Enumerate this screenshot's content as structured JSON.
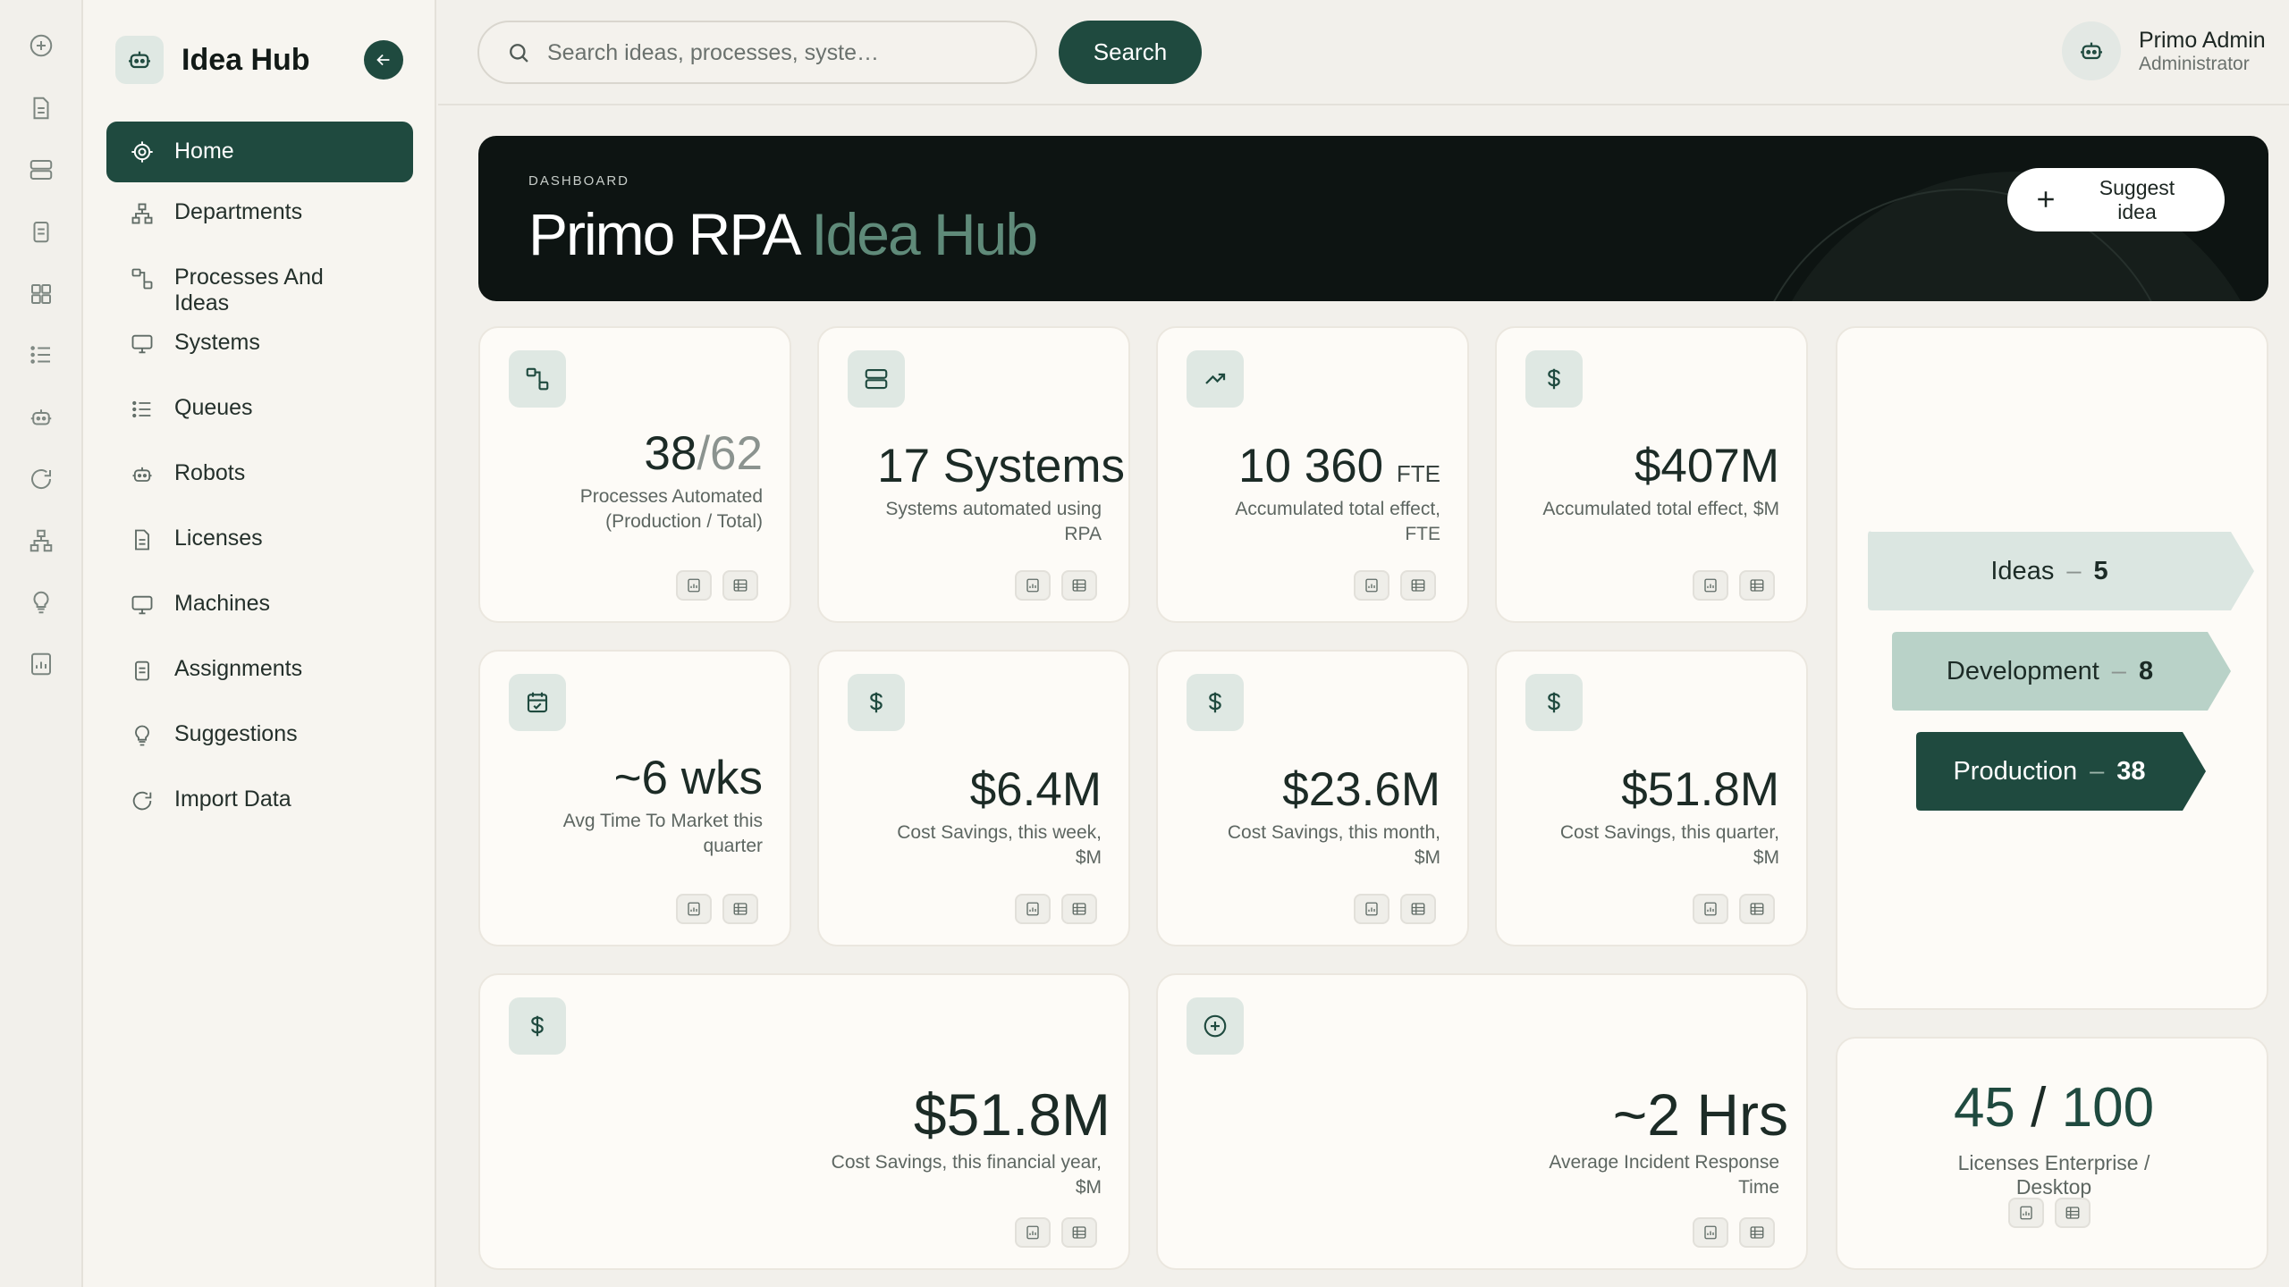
{
  "app": {
    "title": "Idea Hub"
  },
  "rail": {
    "icons": [
      "plus-circle-icon",
      "document-icon",
      "server-icon",
      "clipboard-icon",
      "grid-icon",
      "list-icon",
      "robot-icon",
      "refresh-icon",
      "hierarchy-icon",
      "lightbulb-icon",
      "chart-icon"
    ]
  },
  "sidebar": {
    "items": [
      {
        "label": "Home",
        "icon": "target-icon",
        "active": true
      },
      {
        "label": "Departments",
        "icon": "hierarchy-icon"
      },
      {
        "label": "Processes And\nIdeas",
        "icon": "process-icon"
      },
      {
        "label": "Systems",
        "icon": "monitor-icon"
      },
      {
        "label": "Queues",
        "icon": "list-icon"
      },
      {
        "label": "Robots",
        "icon": "robot-icon"
      },
      {
        "label": "Licenses",
        "icon": "document-icon"
      },
      {
        "label": "Machines",
        "icon": "monitor-icon"
      },
      {
        "label": "Assignments",
        "icon": "clipboard-icon"
      },
      {
        "label": "Suggestions",
        "icon": "lightbulb-icon"
      },
      {
        "label": "Import Data",
        "icon": "refresh-icon"
      }
    ]
  },
  "search": {
    "placeholder": "Search ideas, processes, syste…",
    "button_label": "Search"
  },
  "user": {
    "name": "Primo Admin",
    "role": "Administrator"
  },
  "hero": {
    "eyebrow": "DASHBOARD",
    "title_main": "Primo RPA",
    "title_accent": "Idea Hub",
    "suggest_label": "Suggest\nidea"
  },
  "cards": [
    {
      "icon": "process-icon",
      "value": "38",
      "value_muted": "/62",
      "desc": "Processes Automated\n(Production / Total)"
    },
    {
      "icon": "server-icon",
      "value": "17 Systems",
      "desc": "Systems automated using\nRPA"
    },
    {
      "icon": "trend-up-icon",
      "value": "10 360",
      "unit": "FTE",
      "desc": "Accumulated total effect,\nFTE"
    },
    {
      "icon": "dollar-icon",
      "value": "$407M",
      "desc": "Accumulated total effect, $M"
    },
    {
      "icon": "calendar-icon",
      "value": "~6 wks",
      "desc": "Avg Time To Market this\nquarter"
    },
    {
      "icon": "dollar-icon",
      "value": "$6.4M",
      "desc": "Cost Savings, this week,\n$M"
    },
    {
      "icon": "dollar-icon",
      "value": "$23.6M",
      "desc": "Cost Savings, this month,\n$M"
    },
    {
      "icon": "dollar-icon",
      "value": "$51.8M",
      "desc": "Cost Savings, this quarter,\n$M"
    },
    {
      "icon": "dollar-icon",
      "value": "$51.8M",
      "desc": "Cost Savings, this financial year,\n$M"
    },
    {
      "icon": "plus-circle-icon",
      "value": "~2 Hrs",
      "desc": "Average Incident Response\nTime"
    }
  ],
  "pipeline": [
    {
      "label": "Ideas",
      "count": "5",
      "color": "#dbe6e1"
    },
    {
      "label": "Development",
      "count": "8",
      "color": "#b9d2c8"
    },
    {
      "label": "Production",
      "count": "38",
      "color": "#1f4a3f"
    }
  ],
  "licenses": {
    "used": "45",
    "separator": "/",
    "total": "100",
    "desc": "Licenses Enterprise /\nDesktop"
  },
  "colors": {
    "accent": "#1f4a3f",
    "background": "#f2f0eb",
    "card": "#fdfbf7",
    "hero": "#0d1412",
    "hero_accent": "#5f8a79"
  }
}
